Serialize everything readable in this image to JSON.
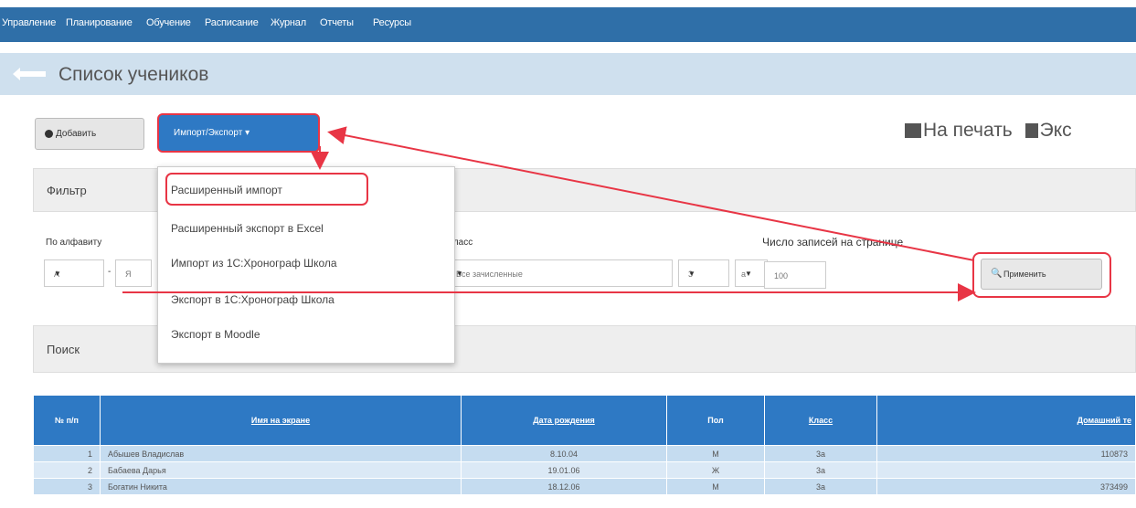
{
  "nav": {
    "items": [
      "Управление",
      "Планирование",
      "Обучение",
      "Расписание",
      "Журнал",
      "Отчеты",
      "Ресурсы"
    ]
  },
  "page": {
    "title": "Список учеников"
  },
  "toolbar": {
    "add_label": "Добавить",
    "import_export_label": "Импорт/Экспорт ▾",
    "print_label": "На печать",
    "export_label": "Экс"
  },
  "filter": {
    "title": "Фильтр",
    "alphabet_label": "По алфавиту",
    "alpha_from": "А",
    "alpha_to": "Я",
    "class_label": "Класс",
    "class_value": "Все зачисленные",
    "grade_value": "3",
    "letter_value": "а",
    "per_page_label": "Число записей на странице",
    "per_page_value": "100",
    "apply_label": "Применить"
  },
  "menu": {
    "items": [
      "Расширенный импорт",
      "Расширенный экспорт в Excel",
      "Импорт из 1С:Хронограф Школа",
      "Экспорт в 1С:Хронограф Школа",
      "Экспорт в Moodle"
    ]
  },
  "search": {
    "title": "Поиск"
  },
  "table": {
    "headers": [
      "№ п/п",
      "Имя на экране",
      "Дата рождения",
      "Пол",
      "Класс",
      "Домашний те"
    ],
    "rows": [
      [
        "1",
        "Абышев Владислав",
        "8.10.04",
        "М",
        "3а",
        "110873"
      ],
      [
        "2",
        "Бабаева Дарья",
        "19.01.06",
        "Ж",
        "3а",
        ""
      ],
      [
        "3",
        "Богатин Никита",
        "18.12.06",
        "М",
        "3а",
        "373499"
      ]
    ]
  },
  "colors": {
    "nav": "#2f6fa8",
    "highlight": "#e83545",
    "header": "#2e79c4"
  }
}
